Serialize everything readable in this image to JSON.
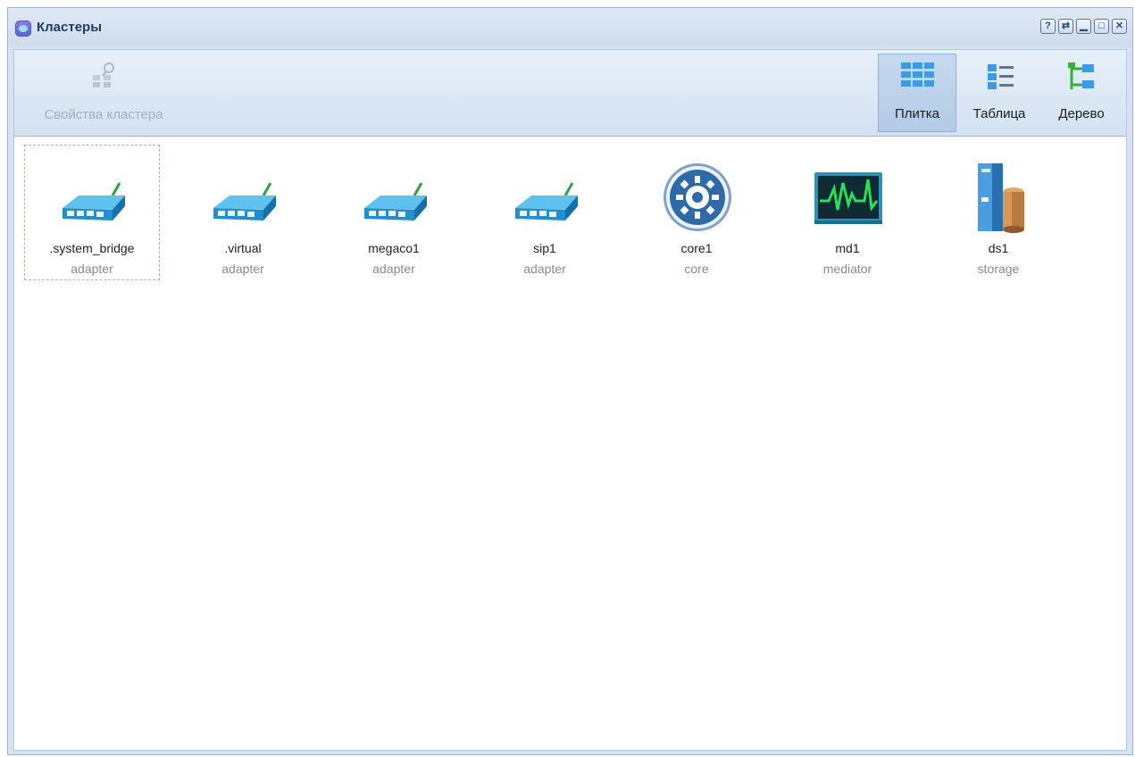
{
  "window": {
    "title": "Кластеры",
    "buttons": [
      {
        "icon": "help-icon",
        "glyph": "?"
      },
      {
        "icon": "refresh-icon",
        "glyph": "⇄"
      },
      {
        "icon": "minimize-icon",
        "glyph": "▁"
      },
      {
        "icon": "maximize-icon",
        "glyph": "□"
      },
      {
        "icon": "close-icon",
        "glyph": "✕"
      }
    ]
  },
  "toolbar": {
    "cluster_properties": "Свойства кластера",
    "views": {
      "tile": "Плитка",
      "table": "Таблица",
      "tree": "Дерево"
    },
    "active_view": "tile"
  },
  "clusters": [
    {
      "name": ".system_bridge",
      "type": "adapter",
      "icon": "adapter-icon",
      "selected": true
    },
    {
      "name": ".virtual",
      "type": "adapter",
      "icon": "adapter-icon"
    },
    {
      "name": "megaco1",
      "type": "adapter",
      "icon": "adapter-icon"
    },
    {
      "name": "sip1",
      "type": "adapter",
      "icon": "adapter-icon"
    },
    {
      "name": "core1",
      "type": "core",
      "icon": "core-gear-icon"
    },
    {
      "name": "md1",
      "type": "mediator",
      "icon": "mediator-monitor-icon"
    },
    {
      "name": "ds1",
      "type": "storage",
      "icon": "storage-server-icon"
    }
  ],
  "colors": {
    "title_text": "#1f3c66",
    "active_view_bg": "#b9cfea",
    "adapter_body": "#1e8fd0",
    "gear_blue": "#2f6aa8",
    "monitor_wave": "#28e05a"
  }
}
